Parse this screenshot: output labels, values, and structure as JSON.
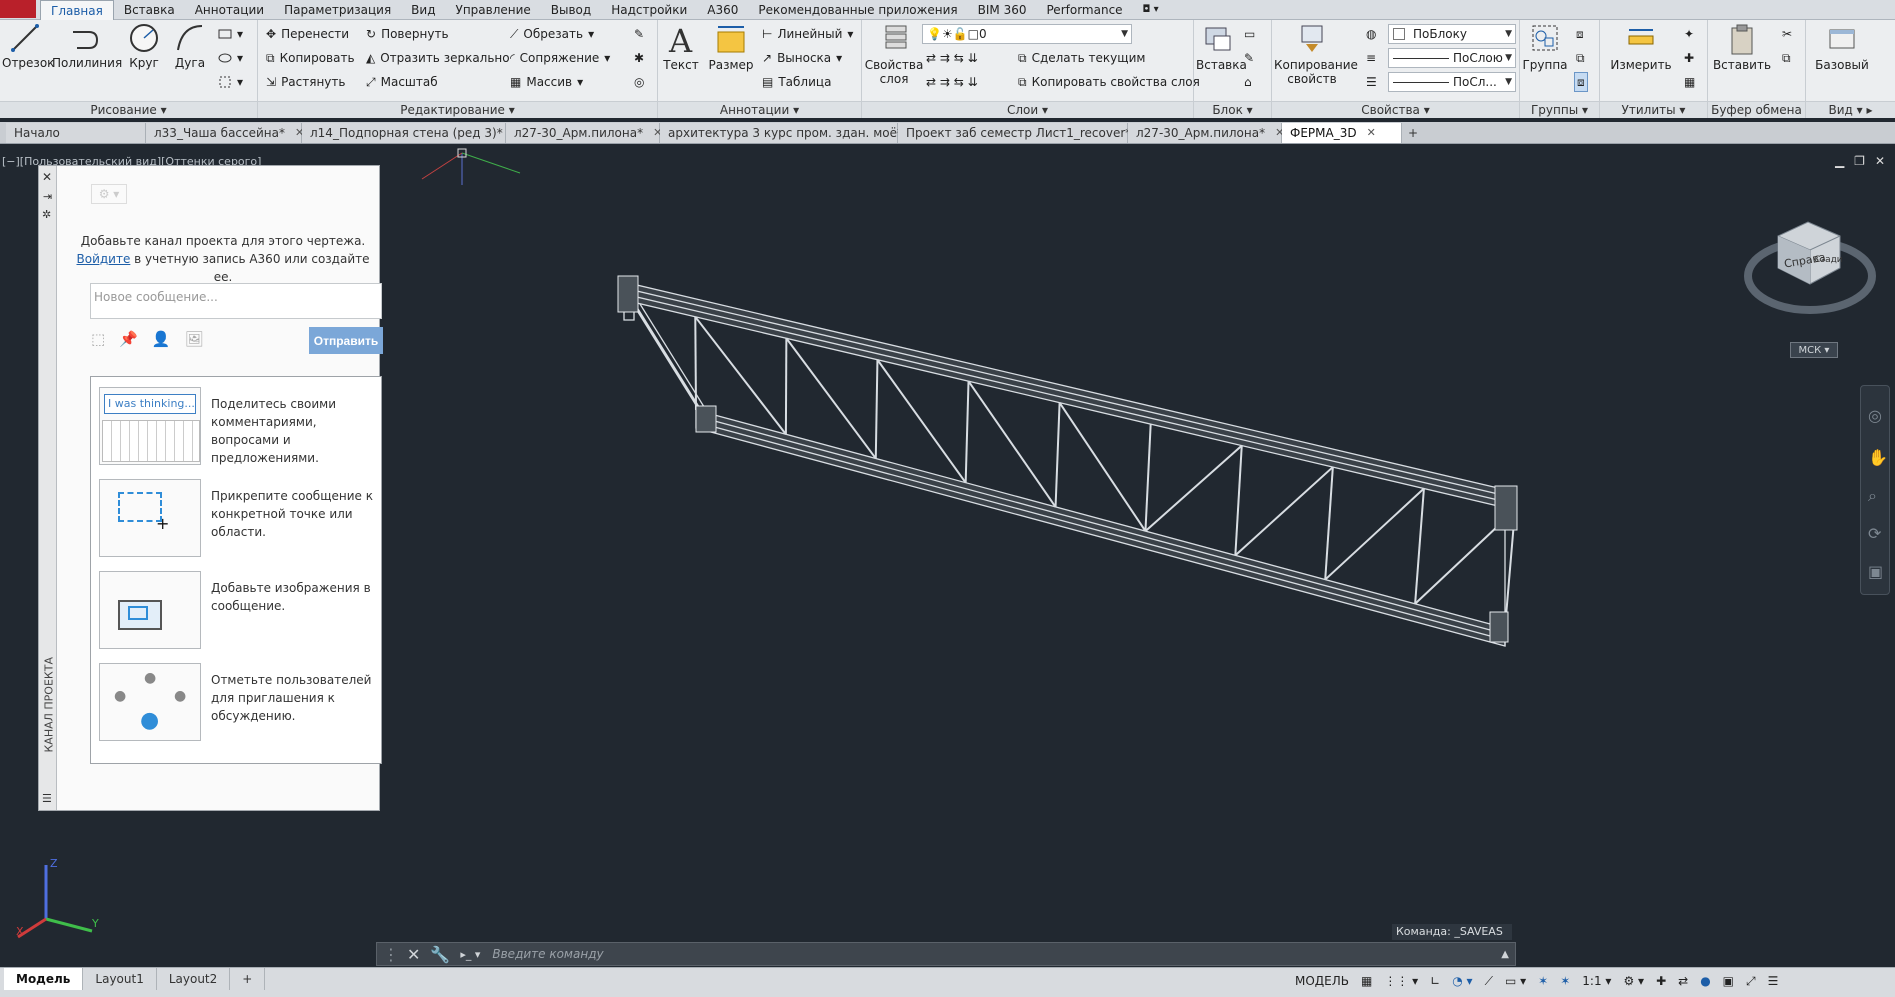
{
  "ribbon": {
    "tabs": [
      "Главная",
      "Вставка",
      "Аннотации",
      "Параметризация",
      "Вид",
      "Управление",
      "Вывод",
      "Надстройки",
      "A360",
      "Рекомендованные приложения",
      "BIM 360",
      "Performance"
    ],
    "active_tab": "Главная",
    "draw": {
      "title": "Рисование",
      "line": "Отрезок",
      "polyline": "Полилиния",
      "circle": "Круг",
      "arc": "Дуга"
    },
    "modify": {
      "title": "Редактирование",
      "move": "Перенести",
      "rotate": "Повернуть",
      "trim": "Обрезать",
      "copy": "Копировать",
      "mirror": "Отразить зеркально",
      "fillet": "Сопряжение",
      "stretch": "Растянуть",
      "scale": "Масштаб",
      "array": "Массив"
    },
    "annotation": {
      "title": "Аннотации",
      "text": "Текст",
      "dimension": "Размер",
      "linear": "Линейный",
      "leader": "Выноска",
      "table": "Таблица"
    },
    "layers": {
      "title": "Слои",
      "properties": "Свойства слоя",
      "layer_value": "0",
      "make_current": "Сделать текущим",
      "match_layer": "Копировать свойства слоя"
    },
    "block": {
      "title": "Блок",
      "insert": "Вставка"
    },
    "properties": {
      "title": "Свойства",
      "match": "Копирование свойств",
      "color": "ПоБлоку",
      "linetype": "ПоСлою",
      "lineweight": "ПоСл..."
    },
    "groups": {
      "title": "Группы",
      "group": "Группа"
    },
    "utilities": {
      "title": "Утилиты",
      "measure": "Измерить"
    },
    "clipboard": {
      "title": "Буфер обмена",
      "paste": "Вставить"
    },
    "view": {
      "title": "Вид",
      "base": "Базовый"
    }
  },
  "doc_tabs": [
    {
      "label": "Начало",
      "modified": false
    },
    {
      "label": "л33_Чаша бассейна*",
      "modified": true
    },
    {
      "label": "л14_Подпорная стена (ред 3)*",
      "modified": true
    },
    {
      "label": "л27-30_Арм.пилона*",
      "modified": true
    },
    {
      "label": "архитектура 3 курс пром. здан. моё*",
      "modified": true
    },
    {
      "label": "Проект заб семестр Лист1_recover*",
      "modified": true
    },
    {
      "label": "л27-30_Арм.пилона*",
      "modified": true
    },
    {
      "label": "ФЕРМА_3D",
      "modified": false
    }
  ],
  "viewport": {
    "label": "[−][Пользовательский вид][Оттенки серого]",
    "cube_right": "Справа",
    "cube_back": "Сзади",
    "wcs": "МСК"
  },
  "palette": {
    "side_title": "КАНАЛ ПРОЕКТА",
    "intro_line1": "Добавьте канал проекта для этого чертежа.",
    "intro_link": "Войдите",
    "intro_line2": " в учетную запись A360 или создайте ее.",
    "placeholder": "Новое сообщение...",
    "send": "Отправить",
    "thumb_text": "I was thinking...",
    "items": [
      "Поделитесь своими комментариями, вопросами и предложениями.",
      "Прикрепите сообщение к конкретной точке или области.",
      "Добавьте изображения в сообщение.",
      "Отметьте пользователей для приглашения к обсуждению."
    ]
  },
  "command": {
    "last": "Команда:  _SAVEAS",
    "placeholder": "Введите  команду"
  },
  "layouts": [
    "Модель",
    "Layout1",
    "Layout2"
  ],
  "status": {
    "mode": "МОДЕЛЬ",
    "scale": "1:1"
  },
  "colors": {
    "background": "#212830",
    "ribbon": "#eceef0",
    "accent": "#1d5ea8",
    "send_button": "#7ba7d8"
  }
}
